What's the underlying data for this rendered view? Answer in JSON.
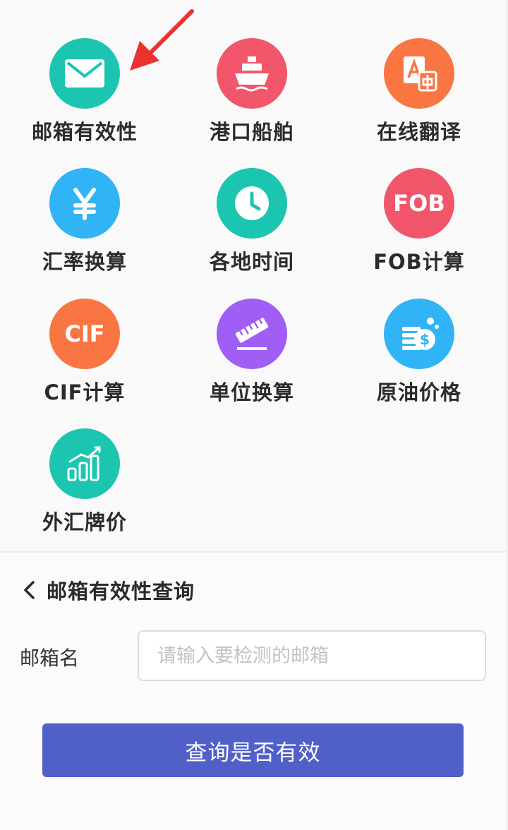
{
  "tools": [
    {
      "label": "邮箱有效性",
      "icon": "mail-icon",
      "color": "#1cc5b0"
    },
    {
      "label": "港口船舶",
      "icon": "ship-icon",
      "color": "#f2566a"
    },
    {
      "label": "在线翻译",
      "icon": "translate-icon",
      "color": "#f97541"
    },
    {
      "label": "汇率换算",
      "icon": "yen-icon",
      "color": "#30b4f5"
    },
    {
      "label": "各地时间",
      "icon": "clock-icon",
      "color": "#1cc5b0"
    },
    {
      "label": "FOB计算",
      "icon": "fob-icon",
      "color": "#f2566a",
      "badge": "FOB"
    },
    {
      "label": "CIF计算",
      "icon": "cif-icon",
      "color": "#f97541",
      "badge": "CIF"
    },
    {
      "label": "单位换算",
      "icon": "ruler-icon",
      "color": "#a15ef4"
    },
    {
      "label": "原油价格",
      "icon": "coins-icon",
      "color": "#30b4f5"
    },
    {
      "label": "外汇牌价",
      "icon": "bar-chart-icon",
      "color": "#1cc5b0"
    }
  ],
  "panel": {
    "title": "邮箱有效性查询",
    "field_label": "邮箱名",
    "input_placeholder": "请输入要检测的邮箱",
    "input_value": "",
    "submit_label": "查询是否有效"
  },
  "colors": {
    "arrow": "#e8332f",
    "button": "#5060c8"
  }
}
